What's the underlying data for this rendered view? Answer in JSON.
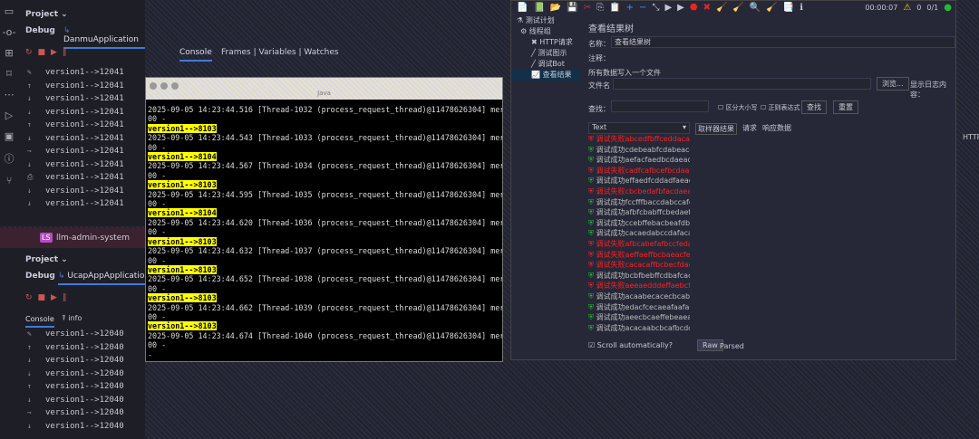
{
  "ide_top": {
    "project": "Project ⌄",
    "debug": "Debug",
    "run_tab": "DanmuApplication",
    "console_tab": "Console",
    "other_tabs": "Frames | Variables | Watches",
    "lines": [
      "version1-->12041",
      "version1-->12041",
      "version1-->12041",
      "version1-->12041",
      "version1-->12041",
      "version1-->12041",
      "version1-->12041",
      "version1-->12041",
      "version1-->12041",
      "version1-->12041",
      "version1-->12041"
    ]
  },
  "ide_bottom": {
    "project_badge": "LS",
    "project_name": "llm-admin-system",
    "project": "Project ⌄",
    "debug": "Debug",
    "run_tab": "UcapAppApplication",
    "console_tab": "Console",
    "info_tab": "info",
    "lines": [
      "version1-->12040",
      "version1-->12040",
      "version1-->12040",
      "version1-->12040",
      "version1-->12040",
      "version1-->12040",
      "version1-->12040",
      "version1-->12040"
    ]
  },
  "console_window": {
    "title": "Java",
    "entries": [
      {
        "log": "2025-09-05 14:23:44.516 [Thread-1032 (process_request_thread)@11478626304] merkzeug IN",
        "version": "version1-->8103"
      },
      {
        "log": "2025-09-05 14:23:44.543 [Thread-1033 (process_request_thread)@11478626304] merkzeug IN",
        "version": "version1-->8104"
      },
      {
        "log": "2025-09-05 14:23:44.567 [Thread-1034 (process_request_thread)@11478626304] merkzeug IN",
        "version": "version1-->8103"
      },
      {
        "log": "2025-09-05 14:23:44.595 [Thread-1035 (process_request_thread)@11478626304] merkzeug IN",
        "version": "version1-->8104"
      },
      {
        "log": "2025-09-05 14:23:44.620 [Thread-1036 (process_request_thread)@11478626304] merkzeug IN",
        "version": "version1-->8103"
      },
      {
        "log": "2025-09-05 14:23:44.632 [Thread-1037 (process_request_thread)@11478626304] merkzeug IN",
        "version": "version1-->8103"
      },
      {
        "log": "2025-09-05 14:23:44.652 [Thread-1038 (process_request_thread)@11478626304] merkzeug IN",
        "version": "version1-->8103"
      },
      {
        "log": "2025-09-05 14:23:44.662 [Thread-1039 (process_request_thread)@11478626304] merkzeug IN",
        "version": "version1-->8103"
      },
      {
        "log": "2025-09-05 14:23:44.674 [Thread-1040 (process_request_thread)@11478626304] merkzeug IN",
        "version": null
      }
    ],
    "tail": "00 -",
    "cursor": "-"
  },
  "jmeter": {
    "timer": "00:00:07",
    "warn_count": "0",
    "threads": "0/1",
    "tree": [
      "测试计划",
      "线程组",
      "HTTP请求",
      "测试图示",
      "调试Bot",
      "查看结果"
    ],
    "panel_title": "查看结果树",
    "name_label": "名称：",
    "name_value": "查看结果树",
    "comment_label": "注释：",
    "write_all": "所有数据写入一个文件",
    "filename_label": "文件名",
    "browse": "浏览...",
    "log_display": "显示日志内容：",
    "search_label": "查找：",
    "case_sensitive": "区分大小写",
    "regex": "正则表达式",
    "search_btn": "查找",
    "reset_btn": "重置",
    "renderer": "Text",
    "tabs": [
      "取样器结果",
      "请求",
      "响应数据"
    ],
    "results": [
      {
        "status": "fail",
        "label": "调试失败abcedfbffceddacad"
      },
      {
        "status": "ok",
        "label": "调试成功cdebeabfcdabeacdce"
      },
      {
        "status": "ok",
        "label": "调试成功aefacfaedbcdaeadbe"
      },
      {
        "status": "fail",
        "label": "调试失败cadfcafbcefbcdaacef"
      },
      {
        "status": "ok",
        "label": "调试成功effaedfcddadfaeaefc"
      },
      {
        "status": "fail",
        "label": "调试失败cbcbedafbfacdaeadce"
      },
      {
        "status": "ok",
        "label": "调试成功fccfffbaccdabccafca"
      },
      {
        "status": "ok",
        "label": "调试成功afbfcbabffcbedaefbfe"
      },
      {
        "status": "ok",
        "label": "调试成功ccebffebacbeafdbccaf"
      },
      {
        "status": "ok",
        "label": "调试成功cacaedabccdafacacfe"
      },
      {
        "status": "fail",
        "label": "调试失败afbcabefafbccfedacae"
      },
      {
        "status": "fail",
        "label": "调试失败aeffaeffbcbaeacfecae"
      },
      {
        "status": "fail",
        "label": "调试失败cacacaffbcbecfdacdb"
      },
      {
        "status": "ok",
        "label": "调试成功bcbfbebffcdbafcacab"
      },
      {
        "status": "fail",
        "label": "调试失败aeeaedddeffaebcfedae"
      },
      {
        "status": "ok",
        "label": "调试成功acaabecacecbcabcae"
      },
      {
        "status": "ok",
        "label": "调试成功edacfcecaeafaafaaafc"
      },
      {
        "status": "ok",
        "label": "调试成功aeecbcaeffebeaeadcf"
      },
      {
        "status": "ok",
        "label": "调试成功acacaabcbcafbcdcdcd"
      }
    ],
    "scroll_auto": "Scroll automatically?",
    "raw": "Raw",
    "parsed": "Parsed"
  },
  "edge_text": "HTTP",
  "colors": {
    "highlight": "#ffff00",
    "fail": "#ff2020",
    "ok_icon": "#22bb33",
    "accent": "#3d7bd9"
  }
}
